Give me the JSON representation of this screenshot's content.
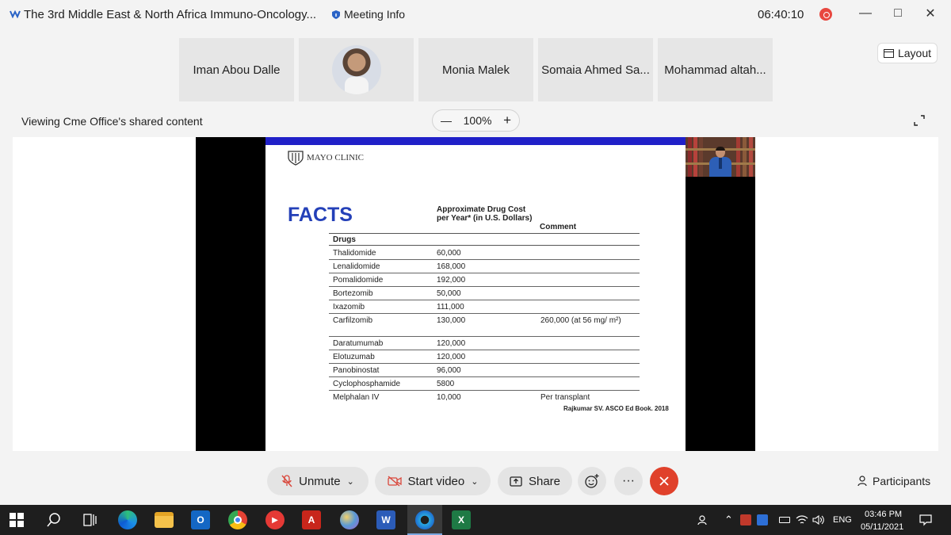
{
  "window": {
    "title": "The 3rd Middle East & North Africa Immuno-Oncology...",
    "meeting_info": "Meeting Info",
    "timer": "06:40:10",
    "controls": [
      "minimize-icon",
      "maximize-icon",
      "close-icon"
    ]
  },
  "participants_strip": {
    "tiles": [
      {
        "name": "Iman Abou Dalle",
        "has_photo": false
      },
      {
        "name": "",
        "has_photo": true
      },
      {
        "name": "Monia Malek",
        "has_photo": false
      },
      {
        "name": "Somaia Ahmed Sa...",
        "has_photo": false
      },
      {
        "name": "Mohammad altah...",
        "has_photo": false
      }
    ],
    "layout_label": "Layout"
  },
  "share_bar": {
    "viewing_text": "Viewing Cme Office's shared content",
    "zoom_level": "100%"
  },
  "slide": {
    "logo_text": "MAYO CLINIC",
    "title": "FACTS",
    "col_cost_header": "Approximate Drug Cost per Year* (in U.S. Dollars)",
    "col_comment_header": "Comment",
    "col_drug_header": "Drugs",
    "rows": [
      {
        "drug": "Thalidomide",
        "cost": "60,000",
        "comment": ""
      },
      {
        "drug": "Lenalidomide",
        "cost": "168,000",
        "comment": ""
      },
      {
        "drug": "Pomalidomide",
        "cost": "192,000",
        "comment": ""
      },
      {
        "drug": "Bortezomib",
        "cost": "50,000",
        "comment": ""
      },
      {
        "drug": "Ixazomib",
        "cost": "111,000",
        "comment": ""
      },
      {
        "drug": "Carfilzomib",
        "cost": "130,000",
        "comment": "260,000 (at 56 mg/ m²)"
      },
      {
        "drug": "Daratumumab",
        "cost": "120,000",
        "comment": ""
      },
      {
        "drug": "Elotuzumab",
        "cost": "120,000",
        "comment": ""
      },
      {
        "drug": "Panobinostat",
        "cost": "96,000",
        "comment": ""
      },
      {
        "drug": "Cyclophosphamide",
        "cost": "5800",
        "comment": ""
      },
      {
        "drug": "Melphalan IV",
        "cost": "10,000",
        "comment": "Per transplant"
      }
    ],
    "citation": "Rajkumar SV. ASCO Ed Book. 2018",
    "accent_color": "#2020c8",
    "title_color": "#2440b8"
  },
  "toolbar": {
    "unmute_label": "Unmute",
    "start_video_label": "Start video",
    "share_label": "Share",
    "participants_label": "Participants",
    "end_color": "#e0412b"
  },
  "taskbar": {
    "time": "03:46 PM",
    "date": "05/11/2021",
    "language": "ENG",
    "apps": [
      "windows-start-icon",
      "search-icon",
      "task-view-icon",
      "edge-icon",
      "file-explorer-icon",
      "outlook-icon",
      "chrome-icon",
      "media-player-icon",
      "acrobat-icon",
      "paint-icon",
      "word-icon",
      "webex-icon",
      "excel-icon"
    ]
  }
}
